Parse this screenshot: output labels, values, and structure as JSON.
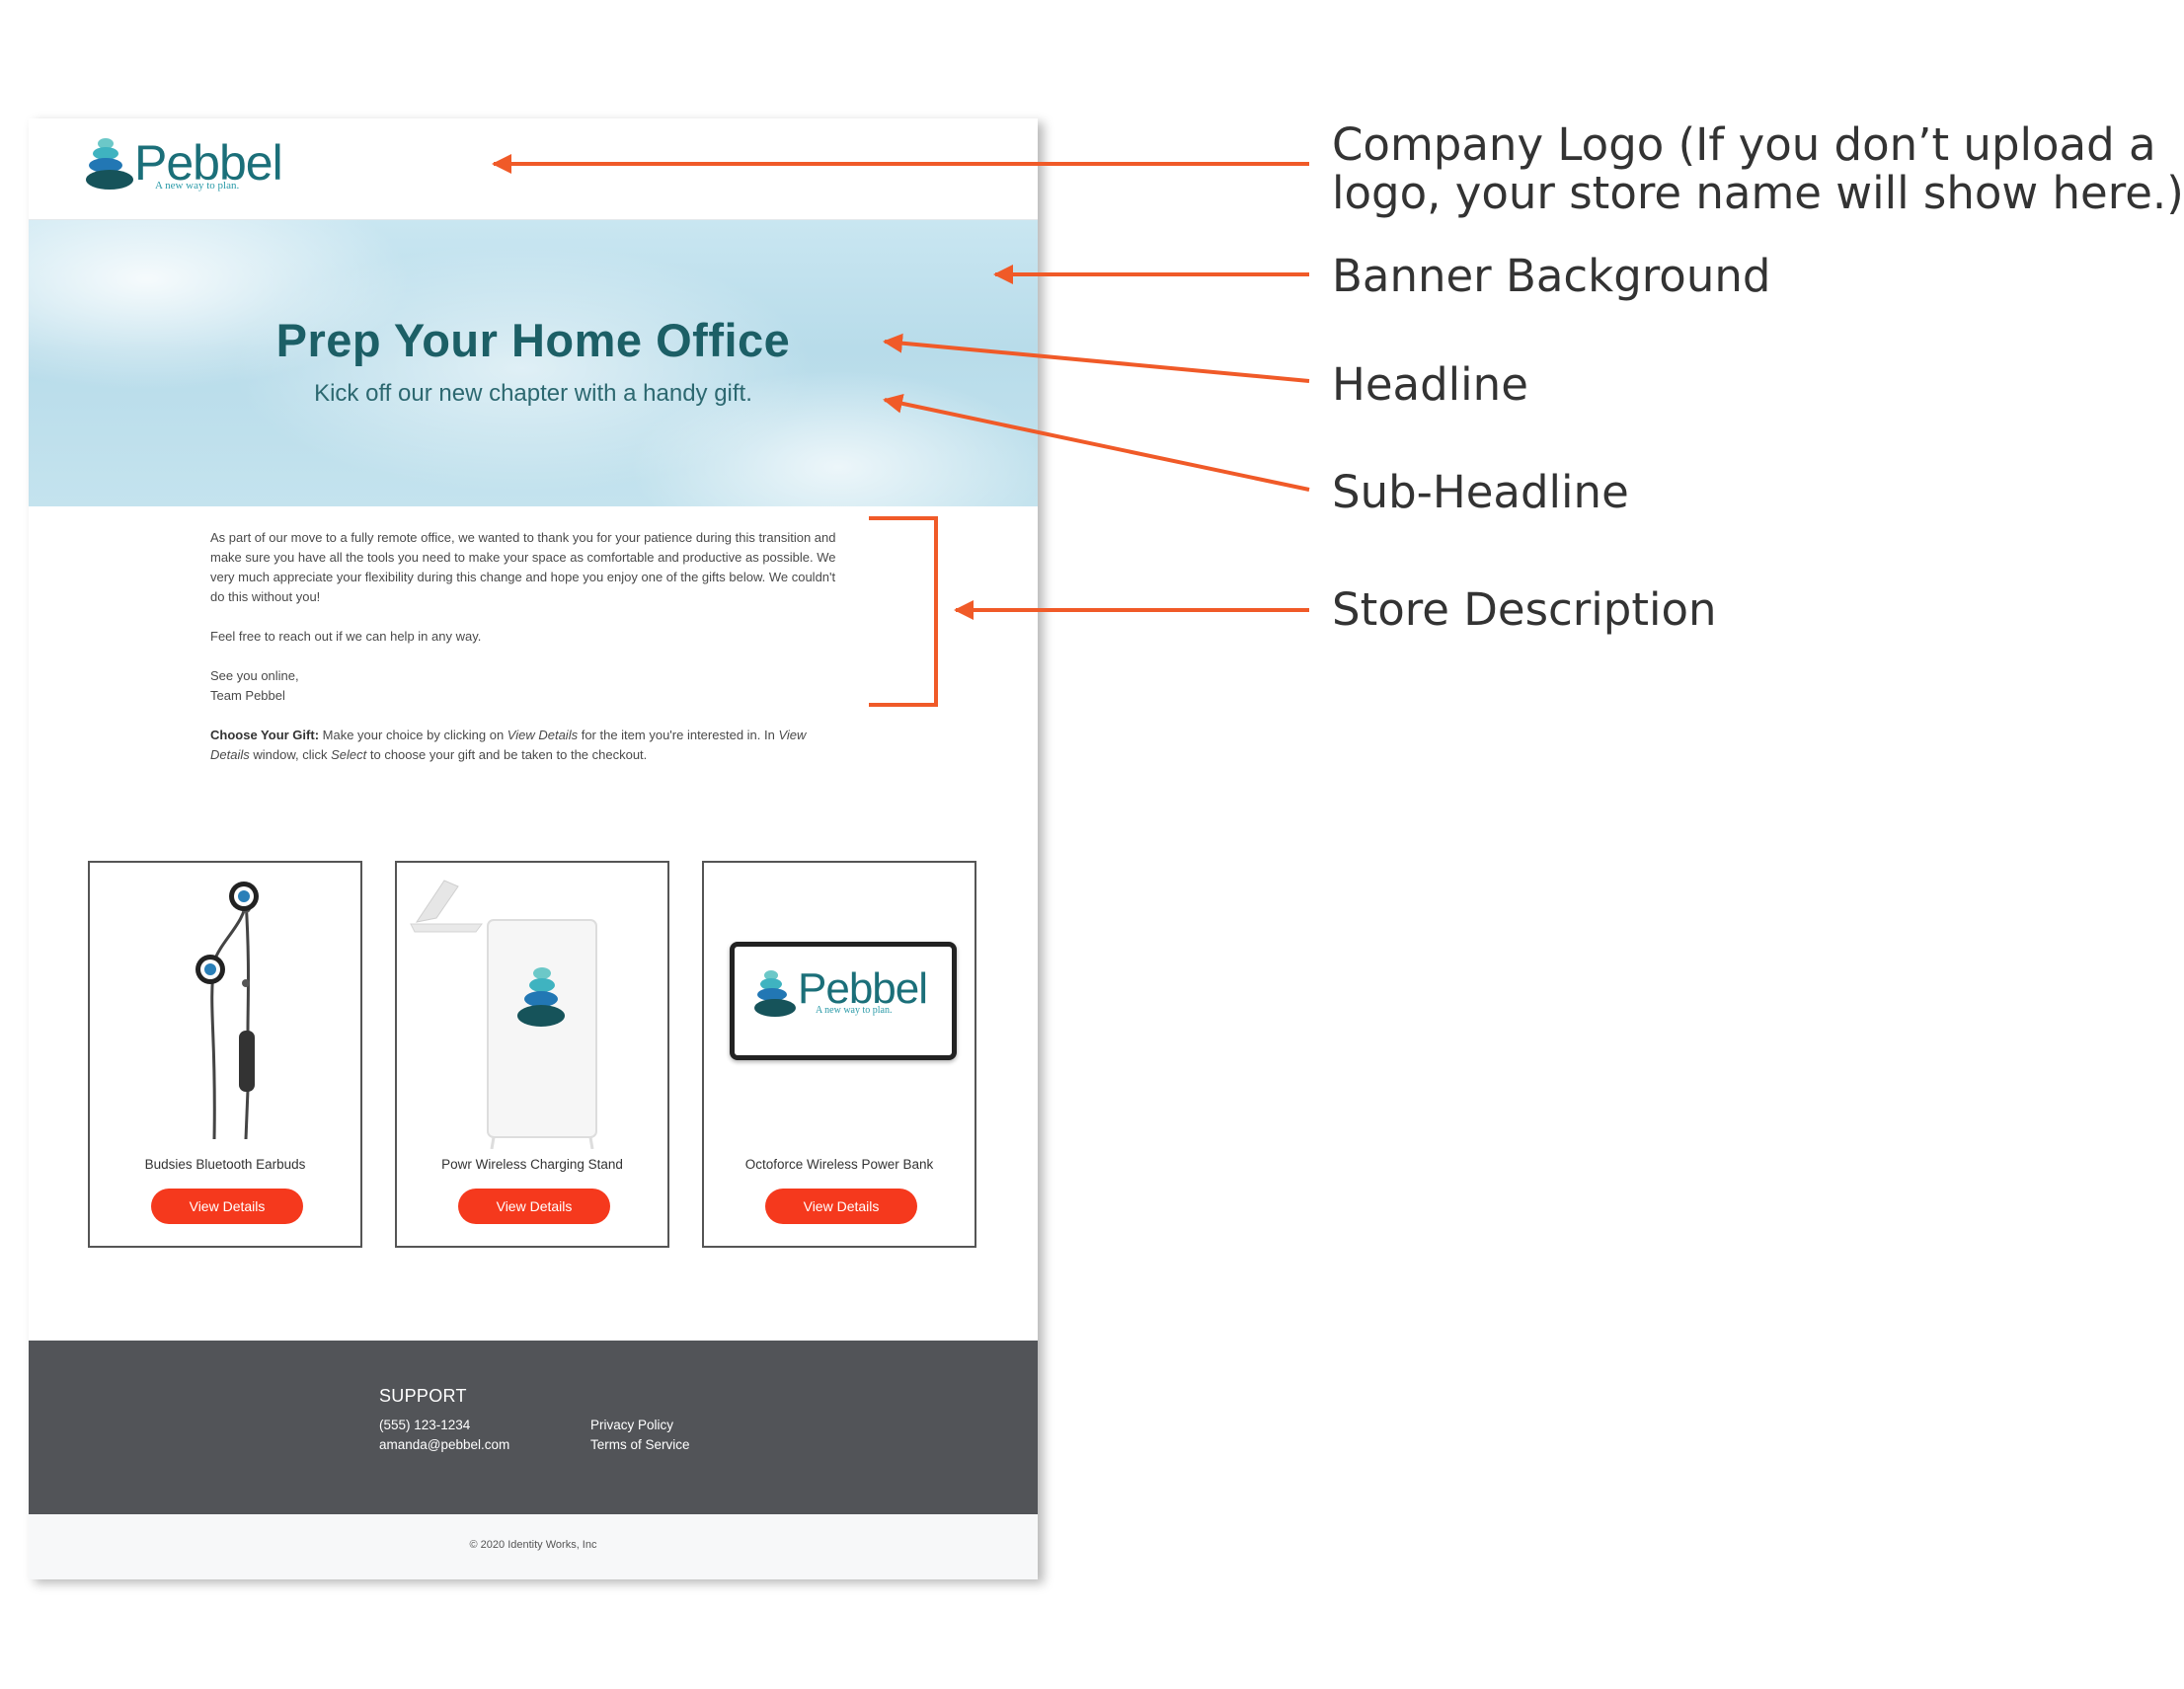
{
  "store": {
    "logo": {
      "wordmark": "Pebbel",
      "tagline": "A new way to plan."
    },
    "banner": {
      "headline": "Prep Your Home Office",
      "subheadline": "Kick off our new chapter with a handy gift."
    },
    "description": {
      "paragraph1": "As part of our move to a fully remote office, we wanted to thank you for your patience during this transition and make sure you have all the tools you need to make your space as comfortable and productive as possible. We very much appreciate your flexibility during this change and hope you enjoy one of the gifts below. We couldn't do this without you!",
      "paragraph2": "Feel free to reach out if we can help in any way.",
      "signoff_line1": "See you online,",
      "signoff_line2": "Team Pebbel",
      "choose_label": "Choose Your Gift:",
      "choose_text_1": " Make your choice by clicking on ",
      "choose_italic_1": "View Details",
      "choose_text_2": " for the item you're interested in. In ",
      "choose_italic_2": "View Details",
      "choose_text_3": " window, click ",
      "choose_italic_3": "Select",
      "choose_text_4": " to choose your gift and be taken to the checkout."
    },
    "products": [
      {
        "name": "Budsies Bluetooth Earbuds",
        "button": "View Details",
        "image": "earbuds-image"
      },
      {
        "name": "Powr Wireless Charging Stand",
        "button": "View Details",
        "image": "charging-stand-image"
      },
      {
        "name": "Octoforce Wireless Power Bank",
        "button": "View Details",
        "image": "power-bank-image"
      }
    ],
    "footer": {
      "support_title": "SUPPORT",
      "phone": "(555) 123-1234",
      "email": "amanda@pebbel.com",
      "privacy": "Privacy Policy",
      "terms": "Terms of Service",
      "copyright": "© 2020 Identity Works, Inc"
    }
  },
  "annotations": {
    "company_logo_line1": "Company Logo (If you don’t upload a",
    "company_logo_line2": "logo, your store name will show here.)",
    "banner_background": "Banner Background",
    "headline": "Headline",
    "sub_headline": "Sub-Headline",
    "store_description": "Store Description"
  },
  "colors": {
    "accent_arrow": "#f05a28",
    "button": "#f5391d",
    "brand_teal": "#1b6f79",
    "footer_bg": "#525458"
  }
}
